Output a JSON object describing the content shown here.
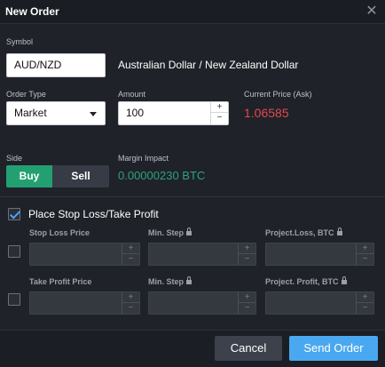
{
  "dialog": {
    "title": "New Order",
    "close_icon": "close-icon"
  },
  "symbol": {
    "label": "Symbol",
    "value": "AUD/NZD",
    "description": "Australian Dollar / New Zealand Dollar"
  },
  "order_type": {
    "label": "Order Type",
    "value": "Market"
  },
  "amount": {
    "label": "Amount",
    "value": "100",
    "increment": "+",
    "decrement": "−"
  },
  "current_price": {
    "label": "Current Price (Ask)",
    "value": "1.06585",
    "color": "#e0494c"
  },
  "side": {
    "label": "Side",
    "buy": "Buy",
    "sell": "Sell",
    "selected": "Buy",
    "buy_color": "#23a072"
  },
  "margin": {
    "label": "Margin Impact",
    "value": "0.00000230 BTC",
    "color": "#2ea27b"
  },
  "stop_loss_take_profit": {
    "checkbox_label": "Place Stop Loss/Take Profit",
    "checked": true,
    "stop_loss": {
      "price_label": "Stop Loss Price",
      "min_step_label": "Min. Step",
      "project_label": "Project.Loss, BTC",
      "plus": "+",
      "minus": "−",
      "checked": false
    },
    "take_profit": {
      "price_label": "Take Profit Price",
      "min_step_label": "Min. Step",
      "project_label": "Project. Profit, BTC",
      "plus": "+",
      "minus": "−",
      "checked": false
    }
  },
  "footer": {
    "cancel": "Cancel",
    "send": "Send Order",
    "send_color": "#4aa8f0"
  }
}
